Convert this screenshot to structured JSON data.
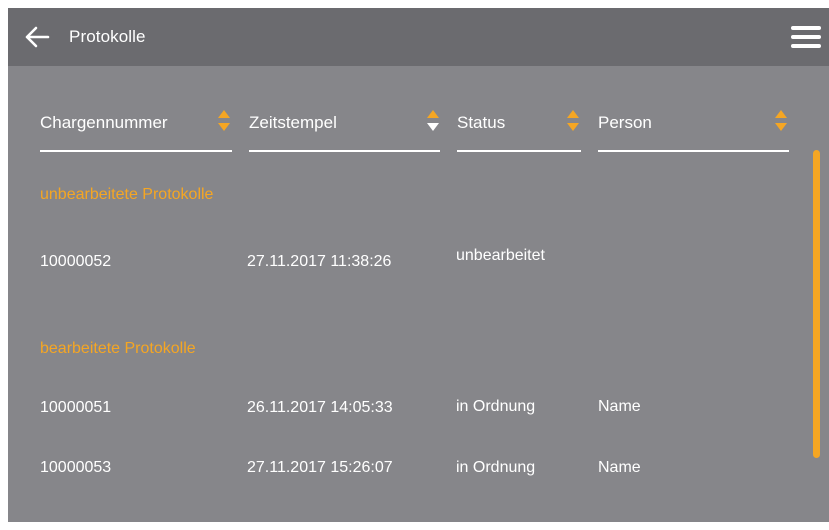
{
  "header": {
    "title": "Protokolle",
    "back_icon": "arrow-left-icon",
    "menu_icon": "hamburger-menu-icon"
  },
  "colors": {
    "accent": "#f5a623",
    "background": "#86868a",
    "header_bg": "#6b6b6f",
    "text": "#ffffff"
  },
  "columns": [
    {
      "label": "Chargennummer",
      "sort": "none"
    },
    {
      "label": "Zeitstempel",
      "sort": "descending"
    },
    {
      "label": "Status",
      "sort": "none"
    },
    {
      "label": "Person",
      "sort": "none"
    }
  ],
  "sections": [
    {
      "title": "unbearbeitete Protokolle",
      "rows": [
        {
          "batch": "10000052",
          "timestamp": "27.11.2017 11:38:26",
          "status": "unbearbeitet",
          "person": ""
        }
      ]
    },
    {
      "title": "bearbeitete Protokolle",
      "rows": [
        {
          "batch": "10000051",
          "timestamp": "26.11.2017 14:05:33",
          "status": "in Ordnung",
          "person": "Name"
        },
        {
          "batch": "10000053",
          "timestamp": "27.11.2017 15:26:07",
          "status": "in Ordnung",
          "person": "Name"
        }
      ]
    }
  ]
}
